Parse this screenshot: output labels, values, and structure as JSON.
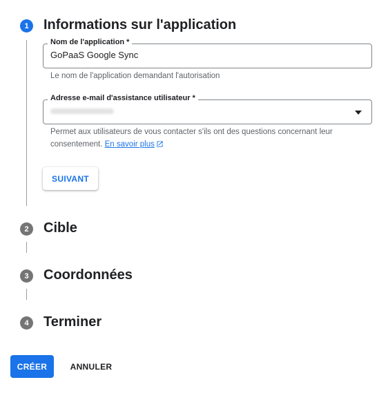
{
  "steps": [
    {
      "number": "1",
      "title": "Informations sur l'application",
      "state": "active"
    },
    {
      "number": "2",
      "title": "Cible",
      "state": "inactive"
    },
    {
      "number": "3",
      "title": "Coordonnées",
      "state": "inactive"
    },
    {
      "number": "4",
      "title": "Terminer",
      "state": "inactive"
    }
  ],
  "app_name_field": {
    "label": "Nom de l'application *",
    "value": "GoPaaS Google Sync",
    "hint": "Le nom de l'application demandant l'autorisation"
  },
  "support_email_field": {
    "label": "Adresse e-mail d'assistance utilisateur *",
    "hint": "Permet aux utilisateurs de vous contacter s'ils ont des questions concernant leur consentement.",
    "link_text": "En savoir plus"
  },
  "buttons": {
    "next": "SUIVANT",
    "create": "CRÉER",
    "cancel": "ANNULER"
  },
  "colors": {
    "accent": "#1a73e8",
    "inactive_step": "#757575"
  },
  "icons": {
    "dropdown": "dropdown-arrow-icon",
    "external_link": "external-link-icon"
  }
}
